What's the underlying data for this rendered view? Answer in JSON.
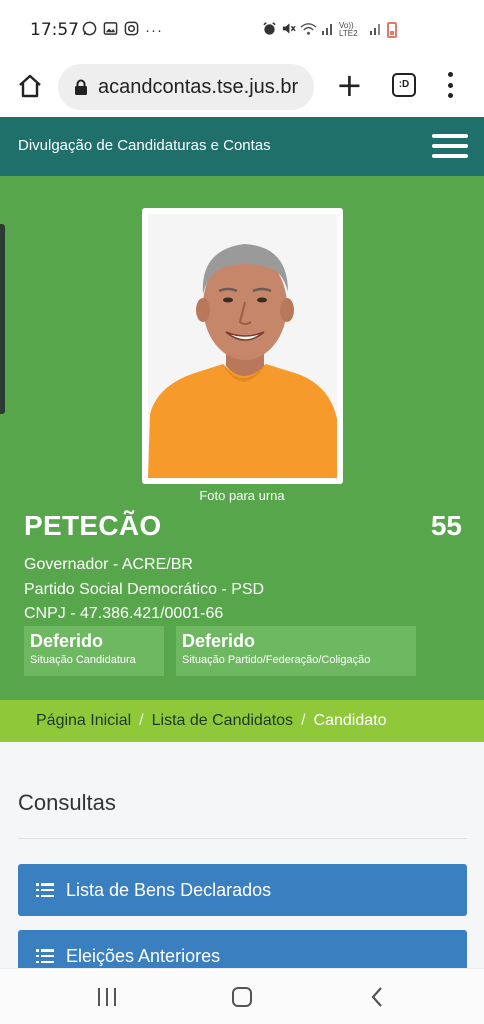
{
  "status_bar": {
    "time": "17:57",
    "left_icons": [
      "whatsapp-icon",
      "gallery-icon",
      "instagram-icon",
      "more-icon"
    ],
    "right_icons": [
      "alarm-icon",
      "mute-icon",
      "wifi-icon",
      "signal-icon",
      "volte-icon",
      "battery-icon"
    ],
    "volte_label": "Vo)) LTE2",
    "overflow": "···"
  },
  "browser": {
    "url": "acandcontas.tse.jus.br",
    "tabs_label": ":D"
  },
  "site_header": {
    "title": "Divulgação de Candidaturas e Contas"
  },
  "candidate": {
    "photo_caption": "Foto para urna",
    "name": "PETECÃO",
    "number": "55",
    "office": "Governador - ACRE/BR",
    "party": "Partido Social Democrático - PSD",
    "cnpj": "CNPJ - 47.386.421/0001-66",
    "badges": [
      {
        "status": "Deferido",
        "label": "Situação Candidatura"
      },
      {
        "status": "Deferido",
        "label": "Situação Partido/Federação/Coligação"
      }
    ]
  },
  "breadcrumb": {
    "items": [
      "Página Inicial",
      "Lista de Candidatos"
    ],
    "current": "Candidato",
    "separator": "/"
  },
  "consultas": {
    "title": "Consultas",
    "buttons": [
      "Lista de Bens Declarados",
      "Eleições Anteriores"
    ]
  },
  "colors": {
    "header": "#1f6f6a",
    "hero": "#58a64c",
    "breadcrumb": "#8fc93a",
    "button": "#3a7fc0"
  }
}
